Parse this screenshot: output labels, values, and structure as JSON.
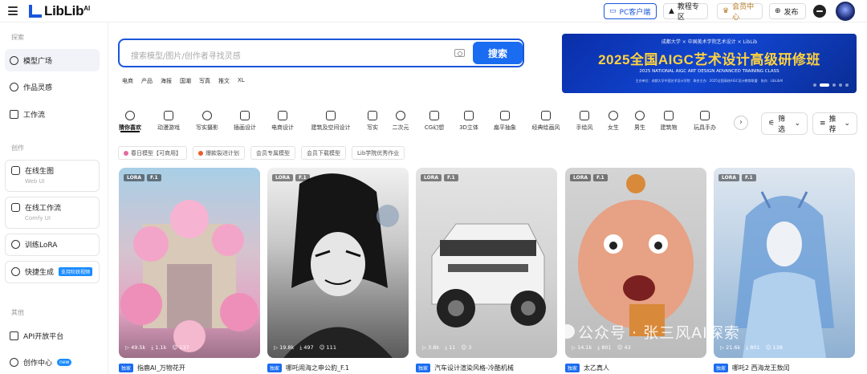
{
  "header": {
    "logo_text": "LibLib",
    "logo_sup": "AI",
    "pc_client": "PC客户端",
    "course": "教程专区",
    "vip": "会员中心",
    "publish": "发布"
  },
  "sidebar": {
    "section_explore": "探索",
    "model_square": "模型广场",
    "inspiration": "作品灵感",
    "workflow": "工作流",
    "section_create": "创作",
    "online_gen": "在线生图",
    "online_gen_sub": "Web UI",
    "online_workflow": "在线工作流",
    "online_workflow_sub": "Comfy UI",
    "train_lora": "训练LoRA",
    "quick_gen": "快捷生成",
    "quick_gen_badge": "支持阶跃视频",
    "section_other": "其他",
    "api": "API开放平台",
    "creator_center": "创作中心",
    "creator_new": "new"
  },
  "search": {
    "placeholder": "搜索模型/图片/创作者寻找灵感",
    "button": "搜索",
    "hot": [
      "电商",
      "产品",
      "海报",
      "国潮",
      "写真",
      "推文",
      "XL"
    ]
  },
  "banner": {
    "top": "成都大学 × 中国美术学院艺术设计 × LibLib",
    "title": "2025全国AIGC艺术设计高级研修班",
    "subtitle": "2025 NATIONAL AIGC ART DESIGN ADVANCED TRAINING CLASS",
    "info": "主办单位：成都大学中国艺术设计学院　联合主办：2025全国高校AIGC设计教育联盟　协办：LibLibAI"
  },
  "categories": [
    "猜你喜欢",
    "动漫游戏",
    "写实摄影",
    "插画设计",
    "电商设计",
    "建筑及空间设计",
    "写实",
    "二次元",
    "CG幻想",
    "3D立体",
    "扁平抽象",
    "经典绘画风",
    "手绘风",
    "女生",
    "男生",
    "建筑物",
    "玩具手办"
  ],
  "filter": "筛选",
  "sort": "推荐",
  "tags": [
    "春日模型【可商用】",
    "爆款裂进计划",
    "会员专属模型",
    "会员下载模型",
    "Lib学院优秀作业"
  ],
  "models": [
    {
      "type": "LORA",
      "base": "F.1",
      "views": "49.5k",
      "downloads": "1.1k",
      "likes": "137",
      "exclusive": "独家",
      "name": "指鹿AI_万物花开"
    },
    {
      "type": "LORA",
      "base": "F.1",
      "views": "19.8k",
      "downloads": "497",
      "likes": "111",
      "exclusive": "独家",
      "name": "哪吒闹海之申公豹_F.1"
    },
    {
      "type": "LORA",
      "base": "F.1",
      "views": "3.8k",
      "downloads": "11",
      "likes": "3",
      "exclusive": "独家",
      "name": "汽车设计渲染风格-冷酷机械"
    },
    {
      "type": "LORA",
      "base": "F.1",
      "views": "14.1k",
      "downloads": "801",
      "likes": "43",
      "exclusive": "独家",
      "name": "太乙真人"
    },
    {
      "type": "LORA",
      "base": "F.1",
      "views": "21.6k",
      "downloads": "801",
      "likes": "138",
      "exclusive": "独家",
      "name": "哪吒2 西海龙王敖闰"
    }
  ],
  "watermark": "公众号 · 张三风AI探索",
  "colors": {
    "accent": "#1a6cf0",
    "banner_title": "#ffd23f"
  }
}
